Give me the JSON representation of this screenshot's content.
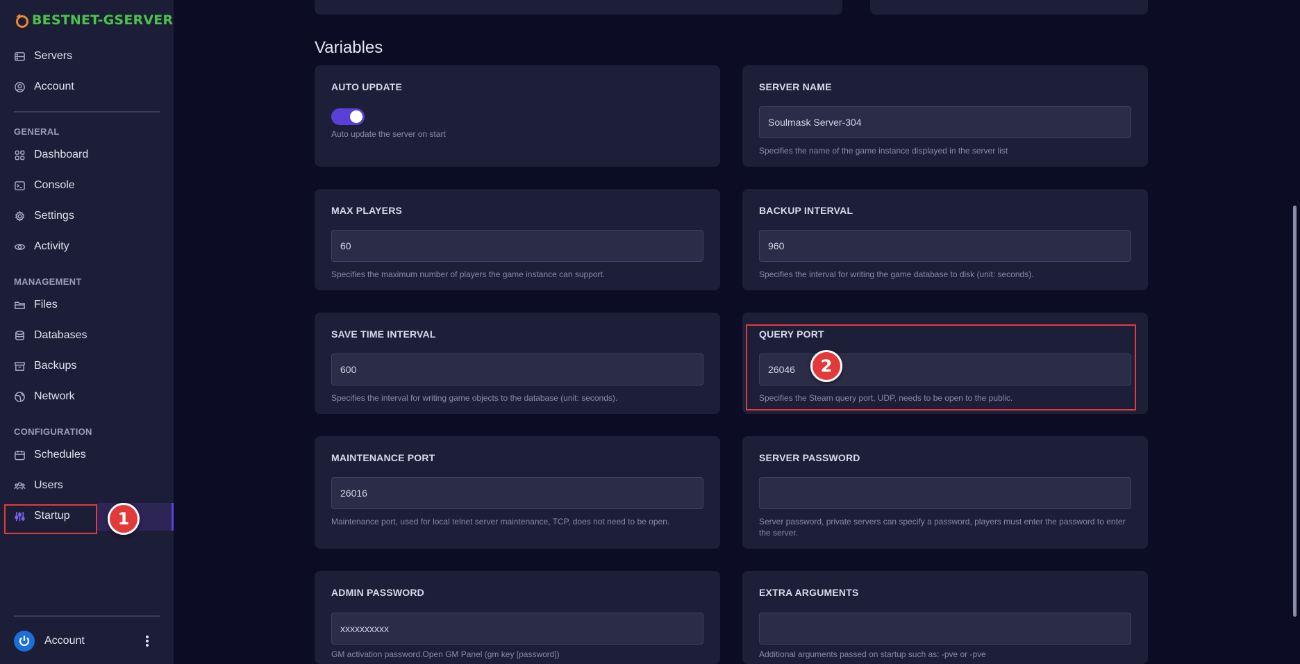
{
  "brand": {
    "name_prefix": "BESTNET-GSERVER"
  },
  "nav": {
    "top": [
      {
        "label": "Servers",
        "icon": "server-icon"
      },
      {
        "label": "Account",
        "icon": "user-circle-icon"
      }
    ],
    "sections": {
      "general": "GENERAL",
      "management": "MANAGEMENT",
      "configuration": "CONFIGURATION"
    },
    "general": [
      {
        "label": "Dashboard",
        "icon": "grid-icon"
      },
      {
        "label": "Console",
        "icon": "terminal-icon"
      },
      {
        "label": "Settings",
        "icon": "gear-icon"
      },
      {
        "label": "Activity",
        "icon": "eye-icon"
      }
    ],
    "management": [
      {
        "label": "Files",
        "icon": "folder-icon"
      },
      {
        "label": "Databases",
        "icon": "database-icon"
      },
      {
        "label": "Backups",
        "icon": "archive-icon"
      },
      {
        "label": "Network",
        "icon": "globe-icon"
      }
    ],
    "configuration": [
      {
        "label": "Schedules",
        "icon": "calendar-icon"
      },
      {
        "label": "Users",
        "icon": "users-icon"
      },
      {
        "label": "Startup",
        "icon": "sliders-icon",
        "active": true
      }
    ],
    "account_bottom": "Account"
  },
  "callouts": {
    "one": "1",
    "two": "2"
  },
  "page": {
    "title": "Variables"
  },
  "variables": {
    "auto_update": {
      "title": "AUTO UPDATE",
      "enabled": true,
      "desc": "Auto update the server on start"
    },
    "server_name": {
      "title": "SERVER NAME",
      "value": "Soulmask Server-304",
      "desc": "Specifies the name of the game instance displayed in the server list"
    },
    "max_players": {
      "title": "MAX PLAYERS",
      "value": "60",
      "desc": "Specifies the maximum number of players the game instance can support."
    },
    "backup_interval": {
      "title": "BACKUP INTERVAL",
      "value": "960",
      "desc": "Specifies the interval for writing the game database to disk (unit: seconds)."
    },
    "save_time_interval": {
      "title": "SAVE TIME INTERVAL",
      "value": "600",
      "desc": "Specifies the interval for writing game objects to the database (unit: seconds)."
    },
    "query_port": {
      "title": "QUERY PORT",
      "value": "26046",
      "desc": "Specifies the Steam query port, UDP, needs to be open to the public."
    },
    "maintenance_port": {
      "title": "MAINTENANCE PORT",
      "value": "26016",
      "desc": "Maintenance port, used for local telnet server maintenance, TCP, does not need to be open."
    },
    "server_password": {
      "title": "SERVER PASSWORD",
      "value": "",
      "desc": "Server password, private servers can specify a password, players must enter the password to enter the server."
    },
    "admin_password": {
      "title": "ADMIN PASSWORD",
      "value": "xxxxxxxxxx",
      "desc": "GM activation password.Open GM Panel (gm key [password])"
    },
    "extra_arguments": {
      "title": "EXTRA ARGUMENTS",
      "value": "",
      "desc": "Additional arguments passed on startup such as: -pve or -pve"
    }
  }
}
